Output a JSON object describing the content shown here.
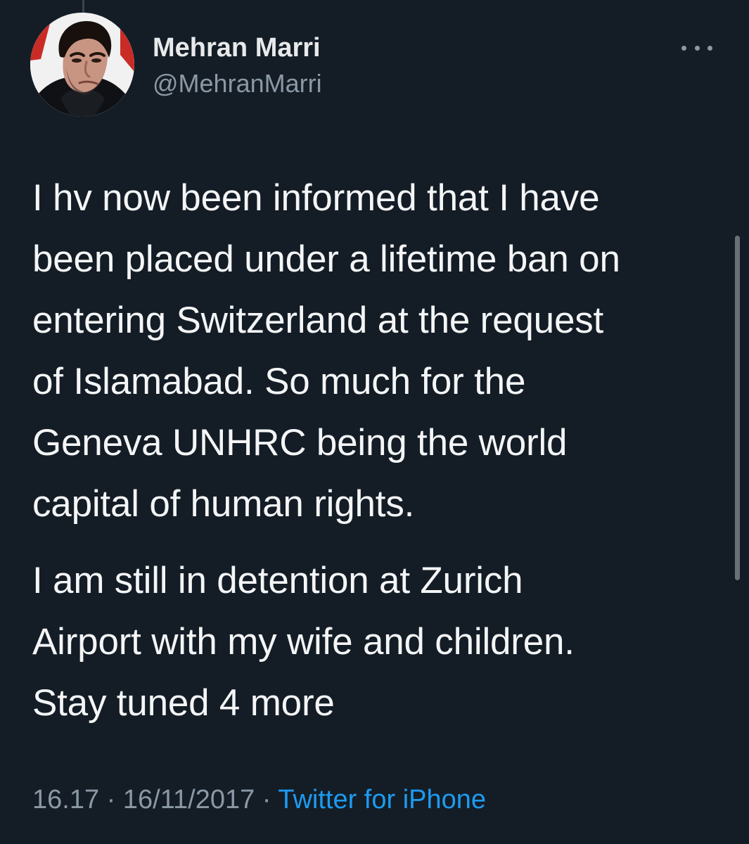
{
  "tweet": {
    "author": {
      "display_name": "Mehran Marri",
      "handle": "@MehranMarri"
    },
    "more_icon": "more-horizontal-icon",
    "paragraph_1": "I hv now been informed that I have\nbeen placed under a lifetime ban on\nentering Switzerland at the request\nof Islamabad. So much for the\nGeneva UNHRC being the world\ncapital of human rights.",
    "paragraph_2": "I am still in detention at Zurich\nAirport with my wife and children.\nStay tuned 4 more",
    "time": "16.17",
    "separator_1": " · ",
    "date": "16/11/2017",
    "separator_2": " · ",
    "source": "Twitter for iPhone"
  },
  "colors": {
    "background": "#141d26",
    "primary_text": "#f4f5f6",
    "secondary_text": "#8b98a5",
    "link": "#1d9bf0"
  }
}
